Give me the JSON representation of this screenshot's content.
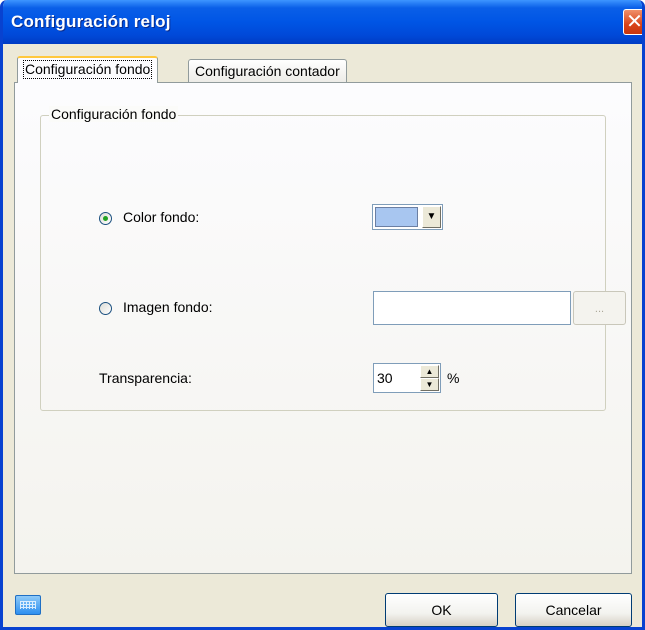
{
  "window": {
    "title": "Configuración reloj",
    "close_glyph": "✕"
  },
  "tabs": [
    {
      "label": "Configuración fondo",
      "active": true
    },
    {
      "label": "Configuración contador",
      "active": false
    }
  ],
  "group": {
    "legend": "Configuración fondo",
    "color_option": {
      "label": "Color fondo:",
      "selected": true,
      "swatch_color": "#a8c6f0",
      "arrow_glyph": "▼"
    },
    "image_option": {
      "label": "Imagen fondo:",
      "selected": false,
      "value": "",
      "browse_label": "..."
    },
    "transparency": {
      "label": "Transparencia:",
      "value": "30",
      "unit": "%",
      "up_glyph": "▲",
      "down_glyph": "▼"
    }
  },
  "footer": {
    "keyboard_icon": "keyboard-icon",
    "ok_label": "OK",
    "cancel_label": "Cancelar"
  },
  "colors": {
    "titlebar": "#0055e5",
    "dialog_bg": "#ece9d8",
    "active_tab_accent": "#ffc83c",
    "radio_dot": "#21a121"
  }
}
